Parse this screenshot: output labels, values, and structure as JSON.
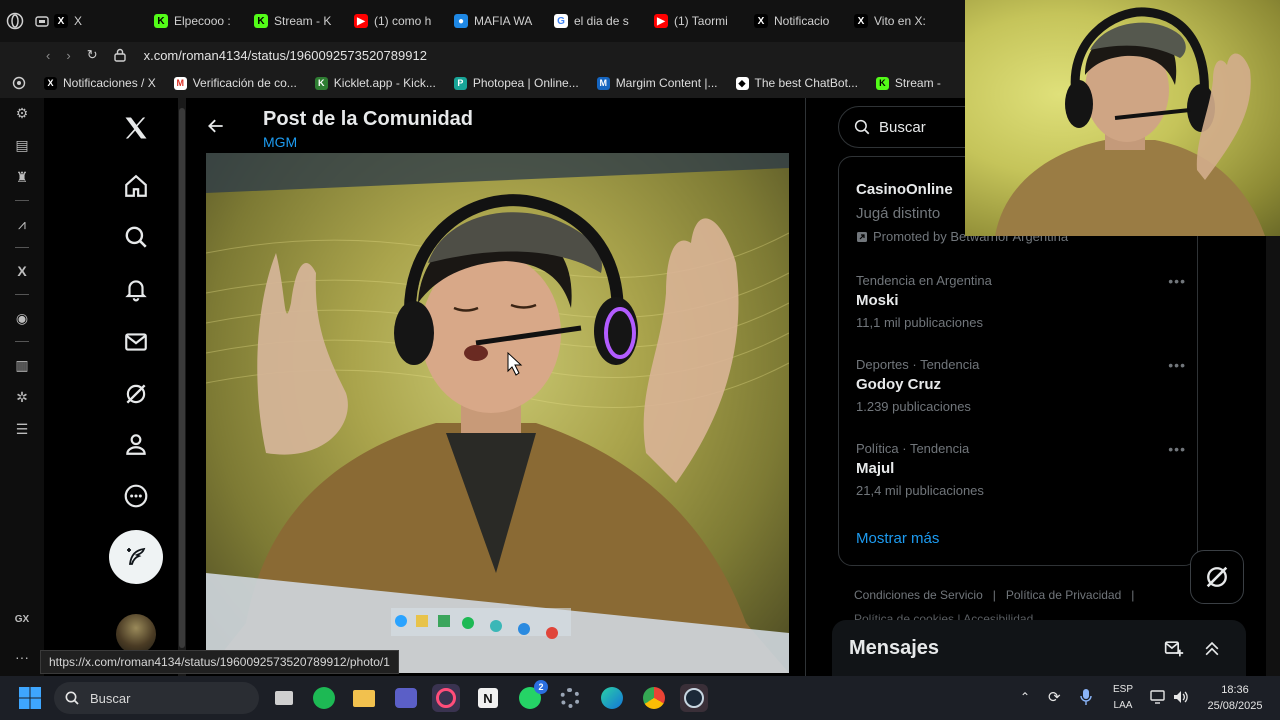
{
  "browser": {
    "tabs": [
      {
        "label": "X",
        "fav": "X",
        "fav_color": "#000000",
        "fav_text": "#ffffff"
      },
      {
        "label": "Elpecooo :",
        "fav": "K",
        "fav_color": "#53fc18",
        "fav_text": "#000000"
      },
      {
        "label": "Stream - K",
        "fav": "K",
        "fav_color": "#53fc18",
        "fav_text": "#000000"
      },
      {
        "label": "(1) como h",
        "fav": "▶",
        "fav_color": "#ff0000",
        "fav_text": "#ffffff"
      },
      {
        "label": "MAFIA WA",
        "fav": "●",
        "fav_color": "#1e88e5",
        "fav_text": "#ffffff"
      },
      {
        "label": "el dia de s",
        "fav": "G",
        "fav_color": "#ffffff",
        "fav_text": "#4285f4"
      },
      {
        "label": "(1) Taormi",
        "fav": "▶",
        "fav_color": "#ff0000",
        "fav_text": "#ffffff"
      },
      {
        "label": "Notificacio",
        "fav": "X",
        "fav_color": "#000000",
        "fav_text": "#ffffff"
      },
      {
        "label": "Vito en X:",
        "fav": "X",
        "fav_color": "#000000",
        "fav_text": "#ffffff"
      }
    ],
    "url": "x.com/roman4134/status/1960092573520789912",
    "bookmarks": [
      {
        "label": "Notificaciones / X",
        "fav": "X",
        "fav_color": "#000000",
        "fav_text": "#ffffff"
      },
      {
        "label": "Verificación de co...",
        "fav": "M",
        "fav_color": "#ffffff",
        "fav_text": "#d93025"
      },
      {
        "label": "Kicklet.app - Kick...",
        "fav": "K",
        "fav_color": "#2e7d32",
        "fav_text": "#ffffff"
      },
      {
        "label": "Photopea | Online...",
        "fav": "P",
        "fav_color": "#18a497",
        "fav_text": "#ffffff"
      },
      {
        "label": "Margim Content |...",
        "fav": "M",
        "fav_color": "#1565c0",
        "fav_text": "#ffffff"
      },
      {
        "label": "The best ChatBot...",
        "fav": "◆",
        "fav_color": "#ffffff",
        "fav_text": "#000000"
      },
      {
        "label": "Stream -",
        "fav": "K",
        "fav_color": "#53fc18",
        "fav_text": "#000000"
      }
    ],
    "status_url": "https://x.com/roman4134/status/1960092573520789912/photo/1"
  },
  "gx_rail": {
    "label": "GX"
  },
  "post": {
    "title": "Post de la Comunidad",
    "community": "MGM"
  },
  "sidebar": {
    "search_placeholder": "Buscar",
    "promo": {
      "name": "CasinoOnline",
      "tagline": "Jugá distinto",
      "promoted_by": "Promoted by Betwarrior Argentina"
    },
    "trends": [
      {
        "context": "Tendencia en Argentina",
        "name": "Moski",
        "count": "11,1 mil publicaciones"
      },
      {
        "context": "Deportes · Tendencia",
        "name": "Godoy Cruz",
        "count": "1.239 publicaciones"
      },
      {
        "context": "Política · Tendencia",
        "name": "Majul",
        "count": "21,4 mil publicaciones"
      }
    ],
    "show_more": "Mostrar más",
    "footer": {
      "terms": "Condiciones de Servicio",
      "privacy": "Política de Privacidad",
      "cookies": "Política de cookies",
      "accessibility": "Accesibilidad"
    },
    "messages_title": "Mensajes"
  },
  "taskbar": {
    "search_label": "Buscar",
    "whatsapp_badge": "2",
    "lang_top": "ESP",
    "lang_bottom": "LAA",
    "time": "18:36",
    "date": "25/08/2025"
  },
  "colors": {
    "accent": "#1d9bf0",
    "muted": "#71767b",
    "border": "#2f3336"
  }
}
